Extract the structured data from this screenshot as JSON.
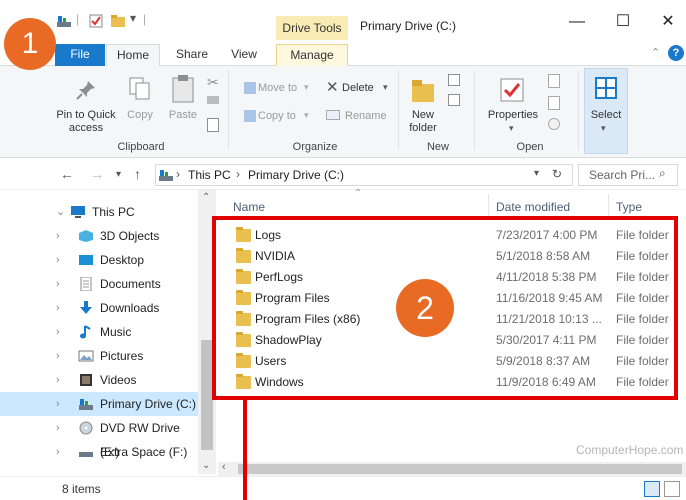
{
  "window": {
    "title": "Primary Drive (C:)",
    "context_tab_label": "Drive Tools",
    "minimize_glyph": "—",
    "maximize_glyph": "☐",
    "close_glyph": "✕"
  },
  "ribbon_tabs": [
    "File",
    "Home",
    "Share",
    "View",
    "Manage"
  ],
  "ribbon": {
    "pin_label": "Pin to Quick access",
    "copy_label": "Copy",
    "paste_label": "Paste",
    "move_to_label": "Move to",
    "delete_label": "Delete",
    "copy_to_label": "Copy to",
    "rename_label": "Rename",
    "new_folder_label": "New folder",
    "properties_label": "Properties",
    "select_label": "Select",
    "groups": [
      "Clipboard",
      "Organize",
      "New",
      "Open"
    ]
  },
  "address": {
    "path": [
      "This PC",
      "Primary Drive (C:)"
    ],
    "search_placeholder": "Search Pri..."
  },
  "nav_pane": {
    "items": [
      {
        "label": "This PC",
        "icon": "pc-icon",
        "expanded": true
      },
      {
        "label": "3D Objects",
        "icon": "3d-objects-icon"
      },
      {
        "label": "Desktop",
        "icon": "desktop-icon"
      },
      {
        "label": "Documents",
        "icon": "documents-icon"
      },
      {
        "label": "Downloads",
        "icon": "downloads-icon"
      },
      {
        "label": "Music",
        "icon": "music-icon"
      },
      {
        "label": "Pictures",
        "icon": "pictures-icon"
      },
      {
        "label": "Videos",
        "icon": "videos-icon"
      },
      {
        "label": "Primary Drive (C:)",
        "icon": "drive-icon",
        "selected": true
      },
      {
        "label": "DVD RW Drive (E:)",
        "icon": "dvd-icon"
      },
      {
        "label": "Extra Space (F:)",
        "icon": "drive-icon"
      }
    ]
  },
  "file_list": {
    "columns": [
      "Name",
      "Date modified",
      "Type"
    ],
    "rows": [
      {
        "name": "Logs",
        "date": "7/23/2017 4:00 PM",
        "type": "File folder"
      },
      {
        "name": "NVIDIA",
        "date": "5/1/2018 8:58 AM",
        "type": "File folder"
      },
      {
        "name": "PerfLogs",
        "date": "4/11/2018 5:38 PM",
        "type": "File folder"
      },
      {
        "name": "Program Files",
        "date": "11/16/2018 9:45 AM",
        "type": "File folder"
      },
      {
        "name": "Program Files (x86)",
        "date": "11/21/2018 10:13 ...",
        "type": "File folder"
      },
      {
        "name": "ShadowPlay",
        "date": "5/30/2017 4:11 PM",
        "type": "File folder"
      },
      {
        "name": "Users",
        "date": "5/9/2018 8:37 AM",
        "type": "File folder"
      },
      {
        "name": "Windows",
        "date": "11/9/2018 6:49 AM",
        "type": "File folder"
      }
    ]
  },
  "status": {
    "items_count": "8 items"
  },
  "annotations": {
    "badge1": "1",
    "badge2": "2",
    "watermark": "ComputerHope.com"
  },
  "colors": {
    "accent": "#1979ca",
    "badge": "#e86a25",
    "highlight": "#e30000",
    "selected": "#cce8ff",
    "drive_tools": "#f8ecb4"
  }
}
